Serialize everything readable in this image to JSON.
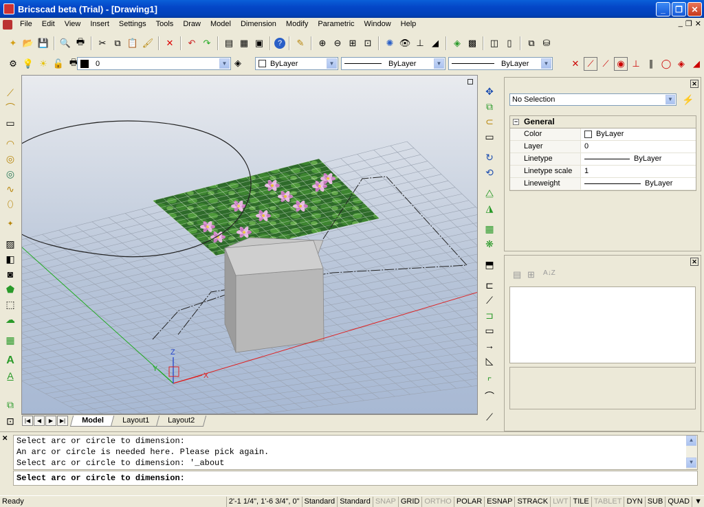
{
  "window": {
    "title": "Bricscad beta (Trial) - [Drawing1]"
  },
  "menu": [
    "File",
    "Edit",
    "View",
    "Insert",
    "Settings",
    "Tools",
    "Draw",
    "Model",
    "Dimension",
    "Modify",
    "Parametric",
    "Window",
    "Help"
  ],
  "layer_toolbar": {
    "layer_value": "0",
    "color_value": "ByLayer",
    "linetype_value": "ByLayer",
    "lineweight_value": "ByLayer"
  },
  "tabs": [
    "Model",
    "Layout1",
    "Layout2"
  ],
  "properties": {
    "selection": "No Selection",
    "section": "General",
    "rows": [
      {
        "key": "Color",
        "value": "ByLayer"
      },
      {
        "key": "Layer",
        "value": "0"
      },
      {
        "key": "Linetype",
        "value": "ByLayer"
      },
      {
        "key": "Linetype scale",
        "value": "1"
      },
      {
        "key": "Lineweight",
        "value": "ByLayer"
      }
    ]
  },
  "command": {
    "log": [
      "Select arc or circle to dimension:",
      "An arc or circle is needed here. Please pick again.",
      "Select arc or circle to dimension: '_about"
    ],
    "prompt": "Select arc or circle to dimension:"
  },
  "status": {
    "ready": "Ready",
    "coords": "2'-1 1/4\", 1'-6 3/4\", 0\"",
    "textstyle": "Standard",
    "dimstyle": "Standard",
    "toggles": [
      {
        "label": "SNAP",
        "on": false
      },
      {
        "label": "GRID",
        "on": true
      },
      {
        "label": "ORTHO",
        "on": false
      },
      {
        "label": "POLAR",
        "on": true
      },
      {
        "label": "ESNAP",
        "on": true
      },
      {
        "label": "STRACK",
        "on": true
      },
      {
        "label": "LWT",
        "on": false
      },
      {
        "label": "TILE",
        "on": true
      },
      {
        "label": "TABLET",
        "on": false
      },
      {
        "label": "DYN",
        "on": true
      },
      {
        "label": "SUB",
        "on": true
      },
      {
        "label": "QUAD",
        "on": true
      }
    ]
  },
  "axis_labels": {
    "x": "X",
    "y": "Y",
    "z": "Z"
  }
}
